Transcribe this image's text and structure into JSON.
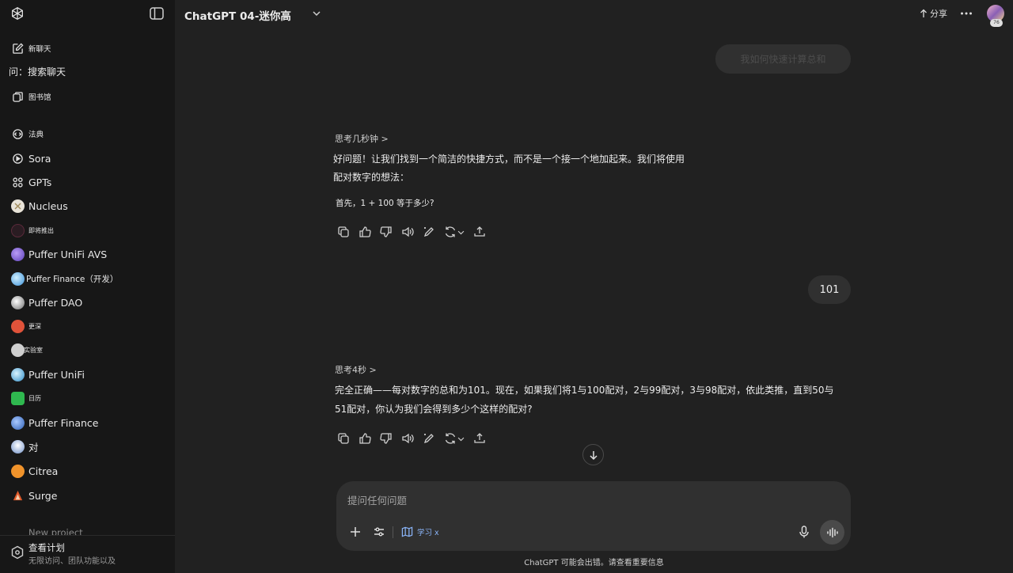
{
  "sidebar": {
    "items": [
      {
        "label": "新聊天",
        "icon": "new-chat-icon"
      },
      {
        "label": "问：搜索聊天",
        "icon": ""
      },
      {
        "label": "图书馆",
        "icon": "library-icon"
      },
      {
        "label": "法典",
        "icon": "codex-icon"
      },
      {
        "label": "Sora",
        "icon": "sora-icon"
      },
      {
        "label": "GPTs",
        "icon": "gpts-icon"
      },
      {
        "label": "Nucleus",
        "icon": "nucleus-avatar"
      },
      {
        "label": "即将推出",
        "icon": "coming-soon-avatar"
      },
      {
        "label": "Puffer UniFi AVS",
        "icon": "puffer-unifi-avs-avatar"
      },
      {
        "label": "Puffer Finance（开发）",
        "icon": "puffer-finance-dev-avatar"
      },
      {
        "label": "Puffer DAO",
        "icon": "puffer-dao-avatar"
      },
      {
        "label": "更深",
        "icon": "deeper-avatar"
      },
      {
        "label": "实验室",
        "icon": "lab-avatar"
      },
      {
        "label": "Puffer UniFi",
        "icon": "puffer-unifi-avatar"
      },
      {
        "label": "日历",
        "icon": "calendar-avatar"
      },
      {
        "label": "Puffer Finance",
        "icon": "puffer-finance-avatar"
      },
      {
        "label": "对",
        "icon": "dui-avatar"
      },
      {
        "label": "Citrea",
        "icon": "citrea-avatar"
      },
      {
        "label": "Surge",
        "icon": "surge-avatar"
      }
    ],
    "faded_item": "New project",
    "upgrade": {
      "title": "查看计划",
      "subtitle": "无限访问、团队功能以及"
    }
  },
  "header": {
    "title": "ChatGPT 04-迷你高",
    "share_label": "分享",
    "avatar_badge": "76"
  },
  "conversation": {
    "user_msg_1": "我如何快速计算总和",
    "think_1": "思考几秒钟 >",
    "reply_1_line1": "好问题！让我们找到一个简洁的快捷方式，而不是一个接一个地加起来。我们将使用",
    "reply_1_line2": "配对数字的想法：",
    "reply_1_line3": "首先，1 + 100 等于多少?",
    "user_msg_2": "101",
    "think_2": "思考4秒 >",
    "reply_2_line1": "完全正确——每对数字的总和为101。现在，如果我们将1与100配对，2与99配对，3与98配对，依此类推，直到50与",
    "reply_2_line2": "51配对，你认为我们会得到多少个这样的配对?"
  },
  "composer": {
    "placeholder": "提问任何问题",
    "study_label": "学习 x"
  },
  "footer": {
    "disclaimer": "ChatGPT 可能会出错。请查看重要信息"
  },
  "colors": {
    "background": "#212121",
    "sidebar": "#171717",
    "bubble": "#303030",
    "accent": "#8ab4f8"
  }
}
